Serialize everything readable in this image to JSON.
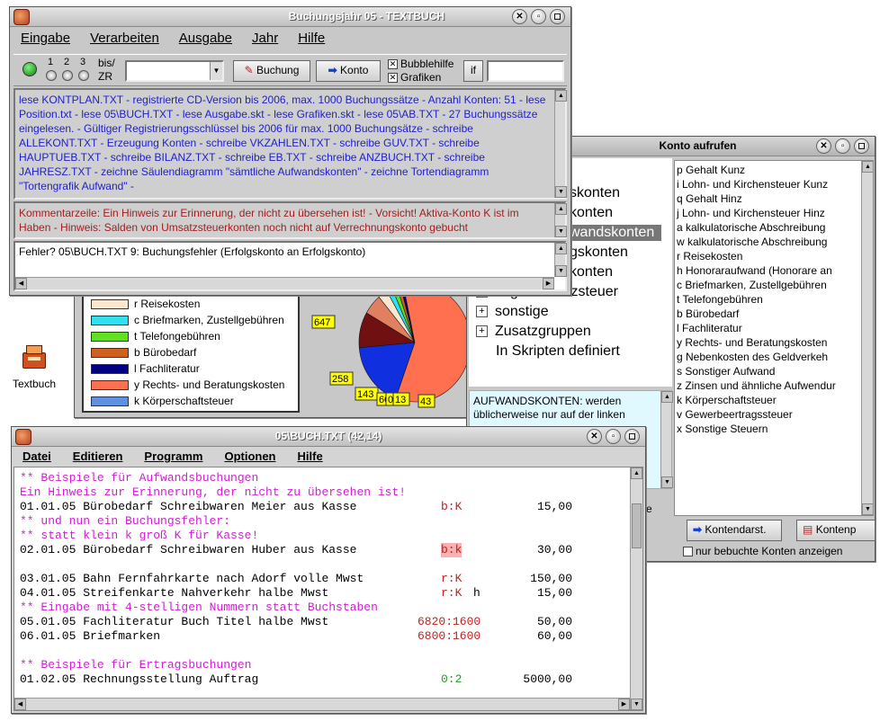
{
  "desktop": {
    "icon_label": "Textbuch"
  },
  "main_window": {
    "title": "Buchungsjahr 05 - TEXTBUCH",
    "menu": [
      "Eingabe",
      "Verarbeiten",
      "Ausgabe",
      "Jahr",
      "Hilfe"
    ],
    "toolbar": {
      "radio_numbers": [
        "1",
        "2",
        "3"
      ],
      "bis_label": "bis/",
      "zr_label": "ZR",
      "buchung_label": "Buchung",
      "konto_label": "Konto",
      "bubblehilfe_label": "Bubblehilfe",
      "grafiken_label": "Grafiken",
      "if_label": "if"
    },
    "log_text": "lese KONTPLAN.TXT - registrierte CD-Version bis 2006, max. 1000 Buchungssätze - Anzahl Konten: 51 - lese Position.txt - lese 05\\BUCH.TXT - lese Ausgabe.skt - lese Grafiken.skt - lese 05\\AB.TXT - 27 Buchungssätze eingelesen. - Gültiger Registrierungsschlüssel bis 2006 für max. 1000 Buchungsätze - schreibe ALLEKONT.TXT - Erzeugung Konten - schreibe VKZAHLEN.TXT - schreibe GUV.TXT - schreibe HAUPTUEB.TXT - schreibe BILANZ.TXT - schreibe EB.TXT - schreibe ANZBUCH.TXT - schreibe JAHRESZ.TXT - zeichne Säulendiagramm \"sämtliche Aufwandskonten\" - zeichne Tortendiagramm \"Tortengrafik Aufwand\" -",
    "comment_text": "Kommentarzeile: Ein Hinweis zur Erinnerung, der nicht zu übersehen ist! - Vorsicht! Aktiva-Konto K ist im Haben - Hinweis: Salden von Umsatzsteuerkonten noch nicht auf Verrechnungskonto gebucht",
    "error_text": "Fehler? 05\\BUCH.TXT 9: Buchungsfehler (Erfolgskonto an Erfolgskonto)"
  },
  "chart_window": {
    "legend": [
      {
        "label": "r Reisekosten",
        "color": "#fbe6cf"
      },
      {
        "label": "c Briefmarken, Zustellgebühren",
        "color": "#30e0f0"
      },
      {
        "label": "t Telefongebühren",
        "color": "#60e020"
      },
      {
        "label": "b Bürobedarf",
        "color": "#d06020"
      },
      {
        "label": "l Fachliteratur",
        "color": "#000080"
      },
      {
        "label": "y Rechts- und Beratungskosten",
        "color": "#ff7050"
      },
      {
        "label": "k Körperschaftsteuer",
        "color": "#6090e0"
      }
    ],
    "pie_labels": [
      "647",
      "258",
      "143",
      "60",
      "0",
      "13",
      "43"
    ]
  },
  "chart_data": {
    "type": "pie",
    "labels_shown": [
      "647",
      "258",
      "143",
      "60",
      "0",
      "13",
      "43"
    ],
    "legend": [
      "r Reisekosten",
      "c Briefmarken, Zustellgebühren",
      "t Telefongebühren",
      "b Bürobedarf",
      "l Fachliteratur",
      "y Rechts- und Beratungskosten",
      "k Körperschaftsteuer"
    ]
  },
  "konto_window": {
    "title": "Konto aufrufen",
    "tree": [
      "skonten",
      "konten",
      "wandskonten",
      "gskonten",
      "konten",
      "bzgl. Umsatzsteuer",
      "sonstige",
      "Zusatzgruppen",
      "In Skripten definiert"
    ],
    "info_text": "AUFWANDSKONTEN: werden üblicherweise nur auf der linken",
    "info_tail": "gabe",
    "accounts": [
      "p Gehalt Kunz",
      "i Lohn- und Kirchensteuer Kunz",
      "q Gehalt Hinz",
      "j Lohn- und Kirchensteuer Hinz",
      "a kalkulatorische Abschreibung",
      "w kalkulatorische Abschreibung",
      "r Reisekosten",
      "h Honoraraufwand (Honorare an",
      "c Briefmarken, Zustellgebühren",
      "t Telefongebühren",
      "b Bürobedarf",
      "l Fachliteratur",
      "y Rechts- und Beratungskosten",
      "g Nebenkosten des Geldverkeh",
      "s Sonstiger Aufwand",
      "z Zinsen und ähnliche Aufwendur",
      "k Körperschaftsteuer",
      "v Gewerbeertragssteuer",
      "x Sonstige Steuern"
    ],
    "kontendarst_label": "Kontendarst.",
    "kontenp_label": "Kontenp",
    "only_booked_label": "nur bebuchte Konten anzeigen"
  },
  "editor_window": {
    "title": "05\\BUCH.TXT (42,14)",
    "menu": [
      "Datei",
      "Editieren",
      "Programm",
      "Optionen",
      "Hilfe"
    ],
    "lines": [
      {
        "text": "** Beispiele für Aufwandsbuchungen",
        "kind": "comment"
      },
      {
        "text": "Ein Hinweis zur Erinnerung, der nicht zu übersehen ist!",
        "kind": "comment"
      },
      {
        "text": "01.01.05 Bürobedarf Schreibwaren Meier aus Kasse",
        "code": "b:K",
        "amount": "15,00",
        "kind": "entry"
      },
      {
        "text": "** und nun ein Buchungsfehler:",
        "kind": "comment"
      },
      {
        "text": "** statt klein k groß K für Kasse!",
        "kind": "comment"
      },
      {
        "text": "02.01.05 Bürobedarf Schreibwaren Huber aus Kasse",
        "code": "b:k",
        "amount": "30,00",
        "kind": "error"
      },
      {
        "text": "",
        "kind": "blank"
      },
      {
        "text": "03.01.05 Bahn Fernfahrkarte nach Adorf volle Mwst",
        "code": "r:K",
        "amount": "150,00",
        "kind": "entry"
      },
      {
        "text": "04.01.05 Streifenkarte Nahverkehr halbe Mwst",
        "code": "r:K",
        "extra": "h",
        "amount": "15,00",
        "kind": "entry"
      },
      {
        "text": "** Eingabe mit 4-stelligen Nummern statt Buchstaben",
        "kind": "comment"
      },
      {
        "text": "05.01.05 Fachliteratur Buch Titel halbe Mwst",
        "code": "6820:1600",
        "amount": "50,00",
        "kind": "entry"
      },
      {
        "text": "06.01.05 Briefmarken",
        "code": "6800:1600",
        "amount": "60,00",
        "kind": "entry"
      },
      {
        "text": "",
        "kind": "blank"
      },
      {
        "text": "** Beispiele für Ertragsbuchungen",
        "kind": "comment"
      },
      {
        "text": "01.02.05 Rechnungsstellung Auftrag",
        "code": "0:2",
        "amount": "5000,00",
        "kind": "income"
      }
    ]
  }
}
